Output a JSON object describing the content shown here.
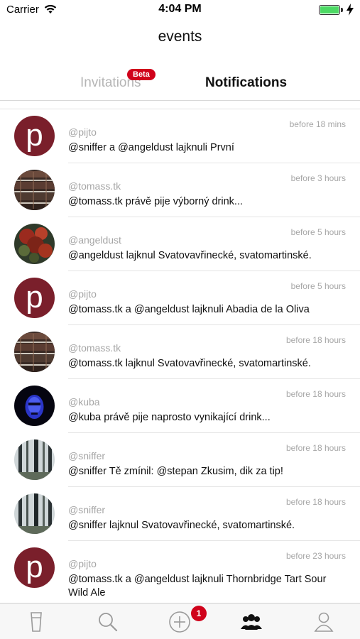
{
  "status_bar": {
    "carrier": "Carrier",
    "time": "4:04 PM",
    "battery_level": 1.0
  },
  "header": {
    "title": "events"
  },
  "tabs": {
    "invitations_label": "Invitations",
    "beta_badge": "Beta",
    "notifications_label": "Notifications",
    "active": "notifications"
  },
  "notifications": [
    {
      "avatar": "pijto",
      "handle": "@pijto",
      "time": "before 18 mins",
      "message": "@sniffer a @angeldust lajknuli První"
    },
    {
      "avatar": "tomass",
      "handle": "@tomass.tk",
      "time": "before 3 hours",
      "message": "@tomass.tk právě pije výborný drink..."
    },
    {
      "avatar": "angeldust",
      "handle": "@angeldust",
      "time": "before 5 hours",
      "message": "@angeldust lajknul Svatovavřinecké, svatomartinské."
    },
    {
      "avatar": "pijto",
      "handle": "@pijto",
      "time": "before 5 hours",
      "message": "@tomass.tk a @angeldust lajknuli Abadia de la Oliva"
    },
    {
      "avatar": "tomass",
      "handle": "@tomass.tk",
      "time": "before 18 hours",
      "message": "@tomass.tk lajknul Svatovavřinecké, svatomartinské."
    },
    {
      "avatar": "kuba",
      "handle": "@kuba",
      "time": "before 18 hours",
      "message": "@kuba právě pije naprosto vynikající drink..."
    },
    {
      "avatar": "sniffer",
      "handle": "@sniffer",
      "time": "before 18 hours",
      "message": "@sniffer Tě zmínil: @stepan Zkusim, dik za tip!"
    },
    {
      "avatar": "sniffer",
      "handle": "@sniffer",
      "time": "before 18 hours",
      "message": "@sniffer lajknul Svatovavřinecké, svatomartinské."
    },
    {
      "avatar": "pijto",
      "handle": "@pijto",
      "time": "before 23 hours",
      "message": "@tomass.tk a @angeldust lajknuli Thornbridge Tart Sour Wild Ale"
    }
  ],
  "tab_bar": {
    "items": [
      {
        "name": "beer-glass-icon",
        "active": false
      },
      {
        "name": "search-icon",
        "active": false
      },
      {
        "name": "add-circle-icon",
        "active": false
      },
      {
        "name": "people-icon",
        "active": true
      },
      {
        "name": "profile-icon",
        "active": false
      }
    ],
    "add_badge": "1"
  },
  "colors": {
    "accent_red": "#d0021b",
    "pijto_avatar": "#7a1f2b",
    "muted_text": "#a6a6a6"
  }
}
